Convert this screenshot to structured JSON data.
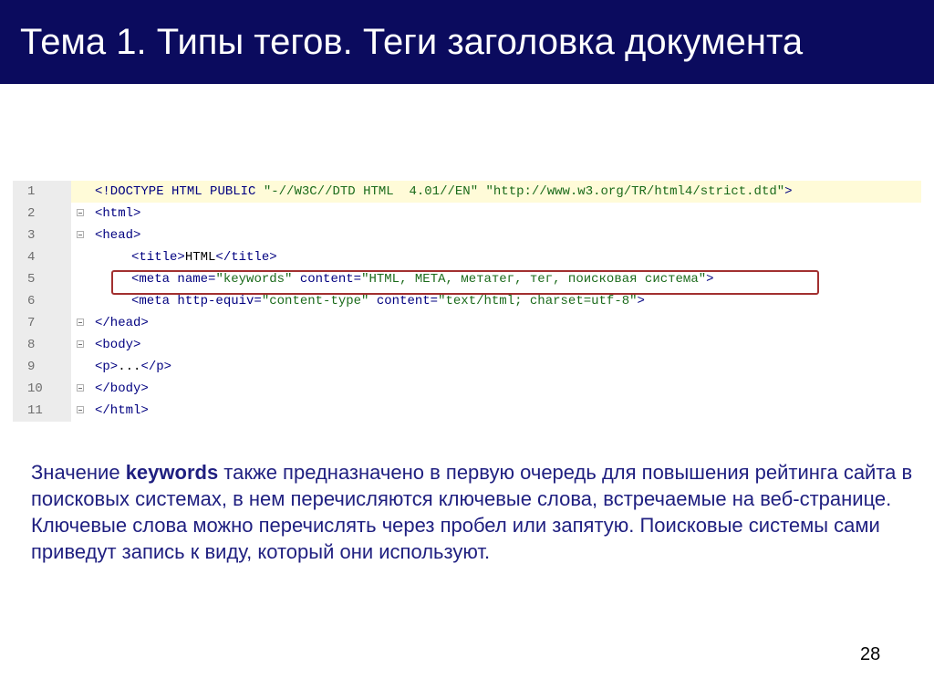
{
  "title": "Тема 1. Типы тегов. Теги заголовка документа",
  "code": {
    "line_numbers": [
      "1",
      "2",
      "3",
      "4",
      "5",
      "6",
      "7",
      "8",
      "9",
      "10",
      "11"
    ],
    "l1": {
      "tag": "<!DOCTYPE",
      "kw1": " HTML",
      "kw2": " PUBLIC",
      "str1": " \"-//W3C//DTD HTML  4.01//EN\"",
      "str2": " \"http://www.w3.org/TR/html4/strict.dtd\"",
      "end": ">"
    },
    "l2": "<html>",
    "l3": "<head>",
    "l4": {
      "open": "<title>",
      "text": "HTML",
      "close": "</title>"
    },
    "l5": {
      "open": "<meta",
      "attr1": " name=",
      "val1": "\"keywords\"",
      "attr2": " content=",
      "val2": "\"HTML, META, метатег, тег, поисковая система\"",
      "end": ">"
    },
    "l6": {
      "open": "<meta",
      "attr1": " http-equiv=",
      "val1": "\"content-type\"",
      "attr2": " content=",
      "val2": "\"text/html; charset=utf-8\"",
      "end": ">"
    },
    "l7": "</head>",
    "l8": "<body>",
    "l9": {
      "open": "<p>",
      "text": "...",
      "close": "</p>"
    },
    "l10": "</body>",
    "l11": "</html>"
  },
  "paragraph": {
    "pre": "Значение ",
    "bold": "keywords",
    "post": " также предназначено в первую очередь для повышения рейтинга сайта в поисковых системах, в нем перечисляются ключевые слова, встречаемые на веб-странице. Ключевые слова можно перечислять через пробел или запятую. Поисковые системы сами приведут запись к виду, который они используют."
  },
  "page_number": "28"
}
